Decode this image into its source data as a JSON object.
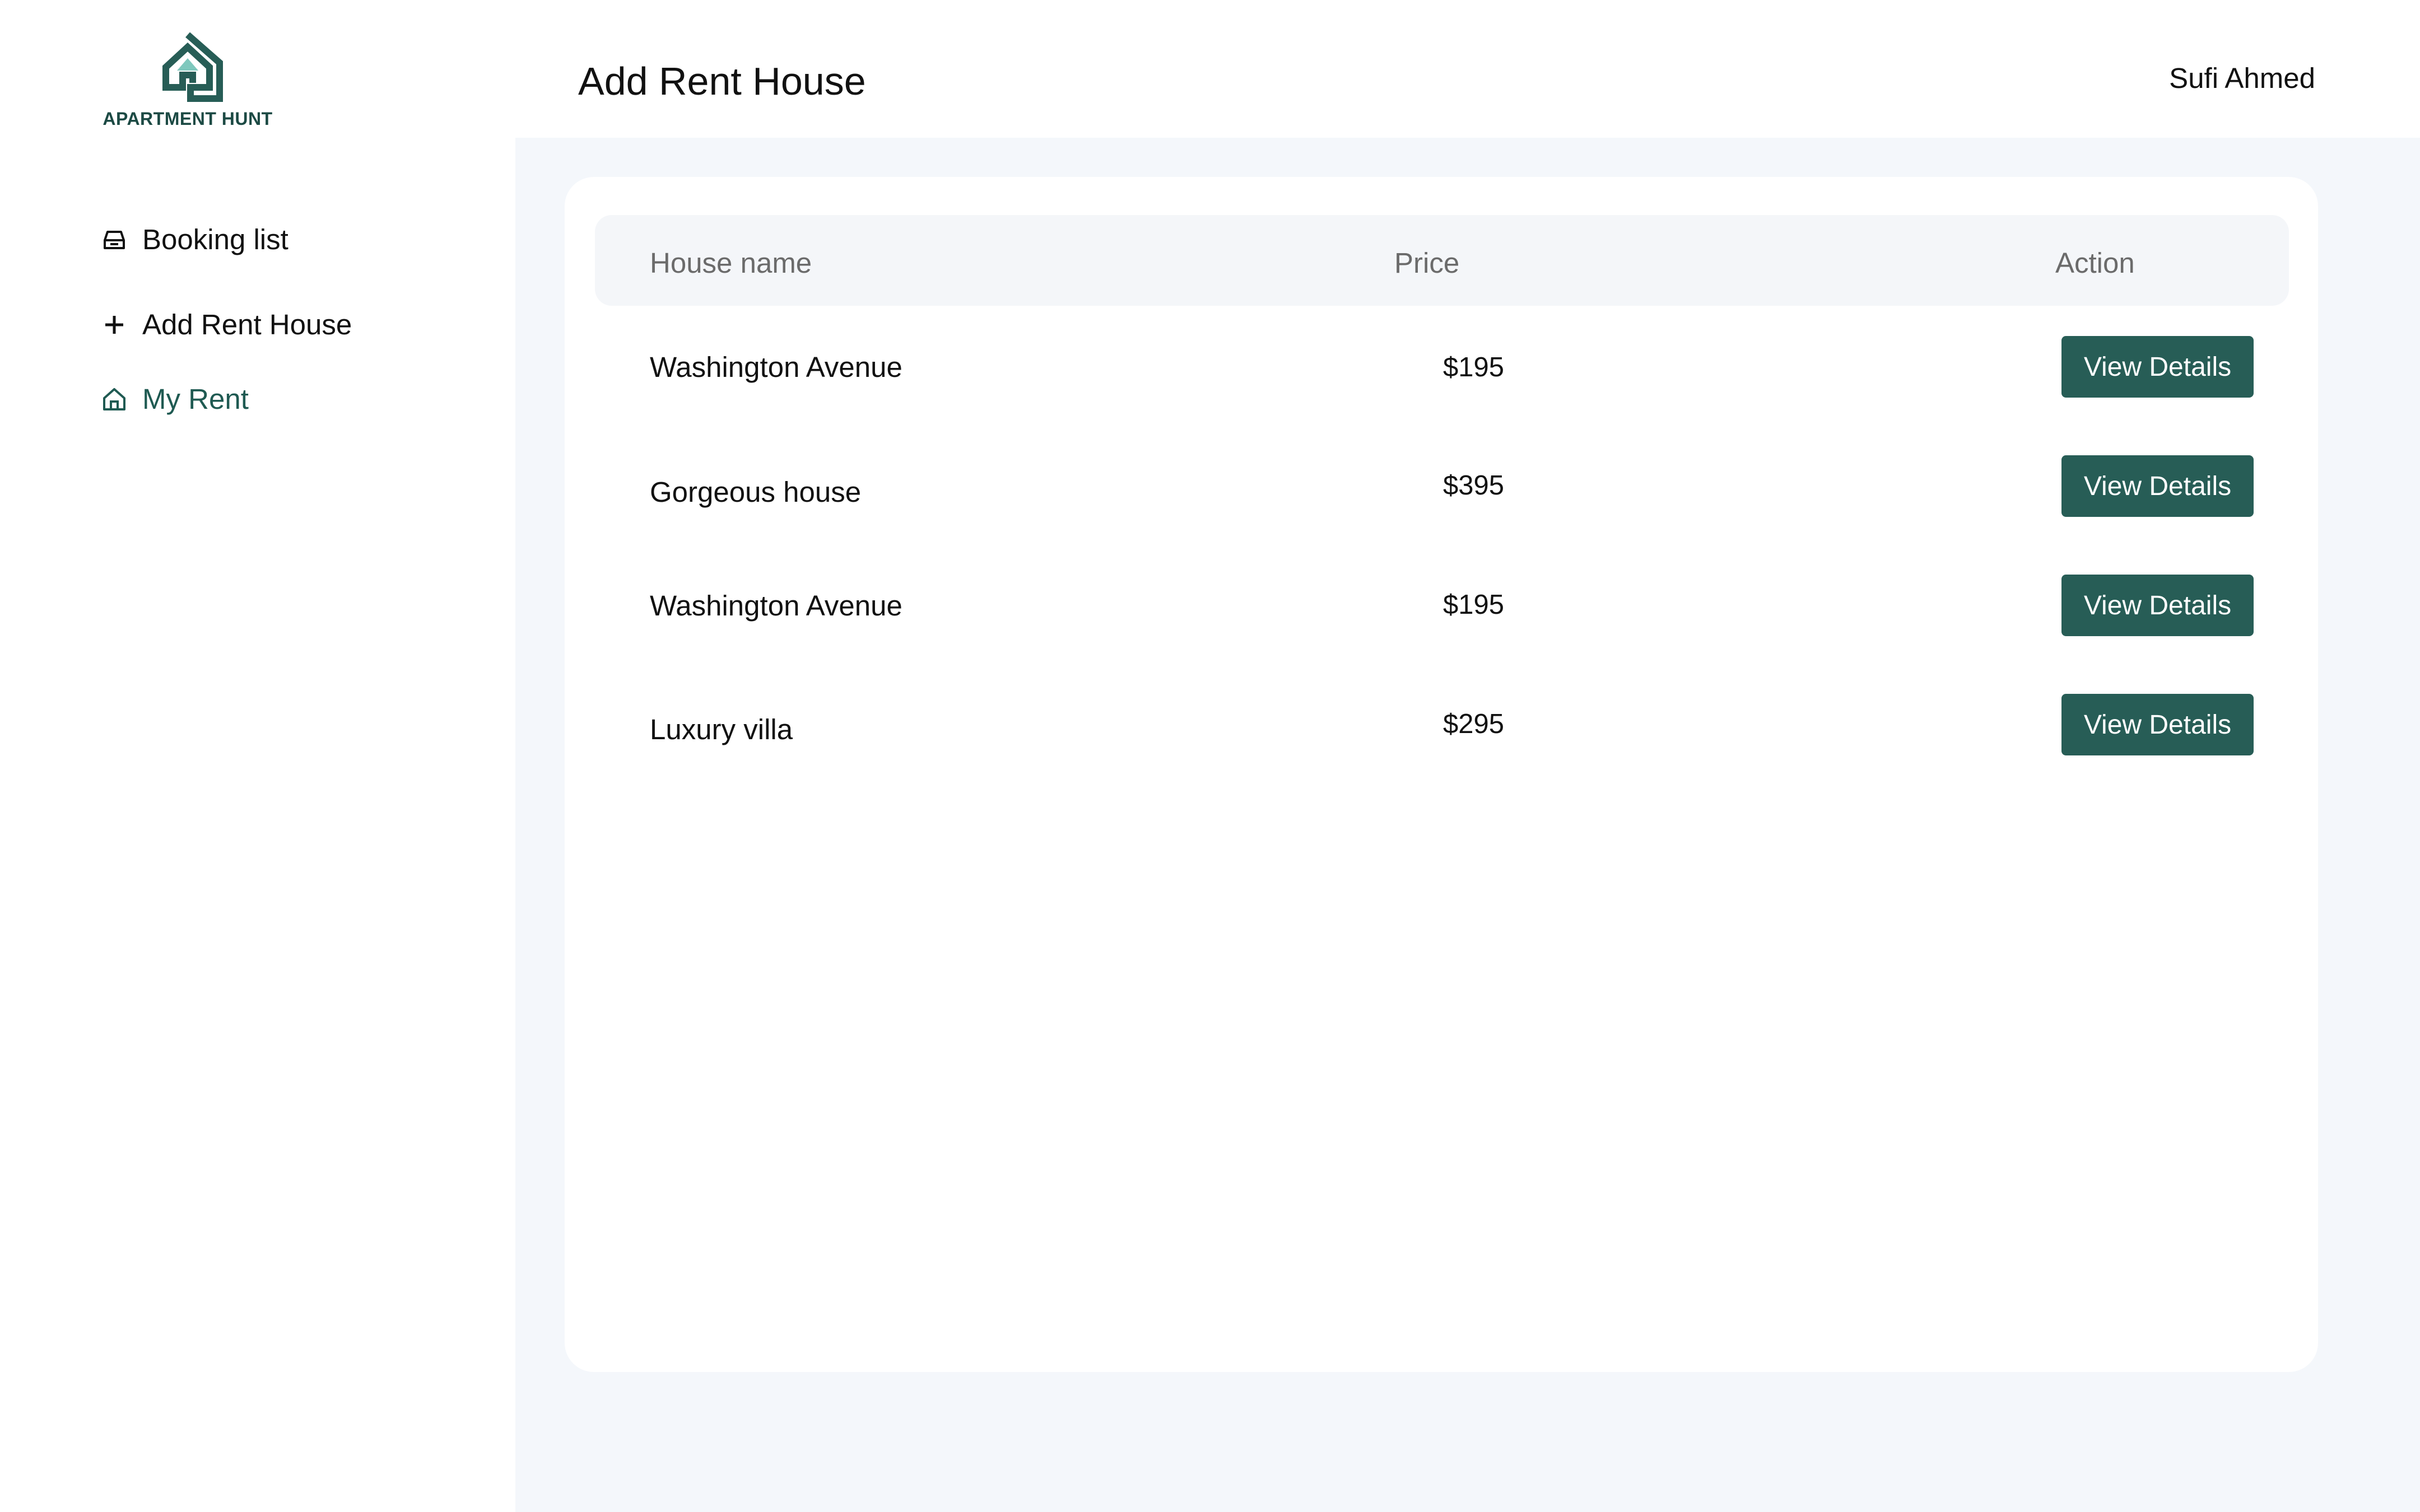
{
  "brand": {
    "name": "APARTMENT HUNT"
  },
  "sidebar": {
    "items": [
      {
        "label": "Booking list",
        "icon": "inbox-icon"
      },
      {
        "label": "Add Rent House",
        "icon": "plus-icon"
      },
      {
        "label": "My Rent",
        "icon": "home-icon",
        "active": true
      }
    ]
  },
  "header": {
    "title": "Add Rent House",
    "user": "Sufi Ahmed"
  },
  "table": {
    "columns": [
      "House name",
      "Price",
      "Action"
    ],
    "rows": [
      {
        "name": "Washington Avenue",
        "price": "$195",
        "action": "View Details"
      },
      {
        "name": "Gorgeous house",
        "price": "$395",
        "action": "View Details"
      },
      {
        "name": "Washington Avenue",
        "price": "$195",
        "action": "View Details"
      },
      {
        "name": "Luxury villa",
        "price": "$295",
        "action": "View Details"
      }
    ]
  },
  "colors": {
    "accent": "#275d56",
    "brand_dark": "#1c4a44",
    "brand_light": "#7fc8bd",
    "main_bg": "#f4f7fb",
    "table_header_bg": "#f4f6f9"
  }
}
